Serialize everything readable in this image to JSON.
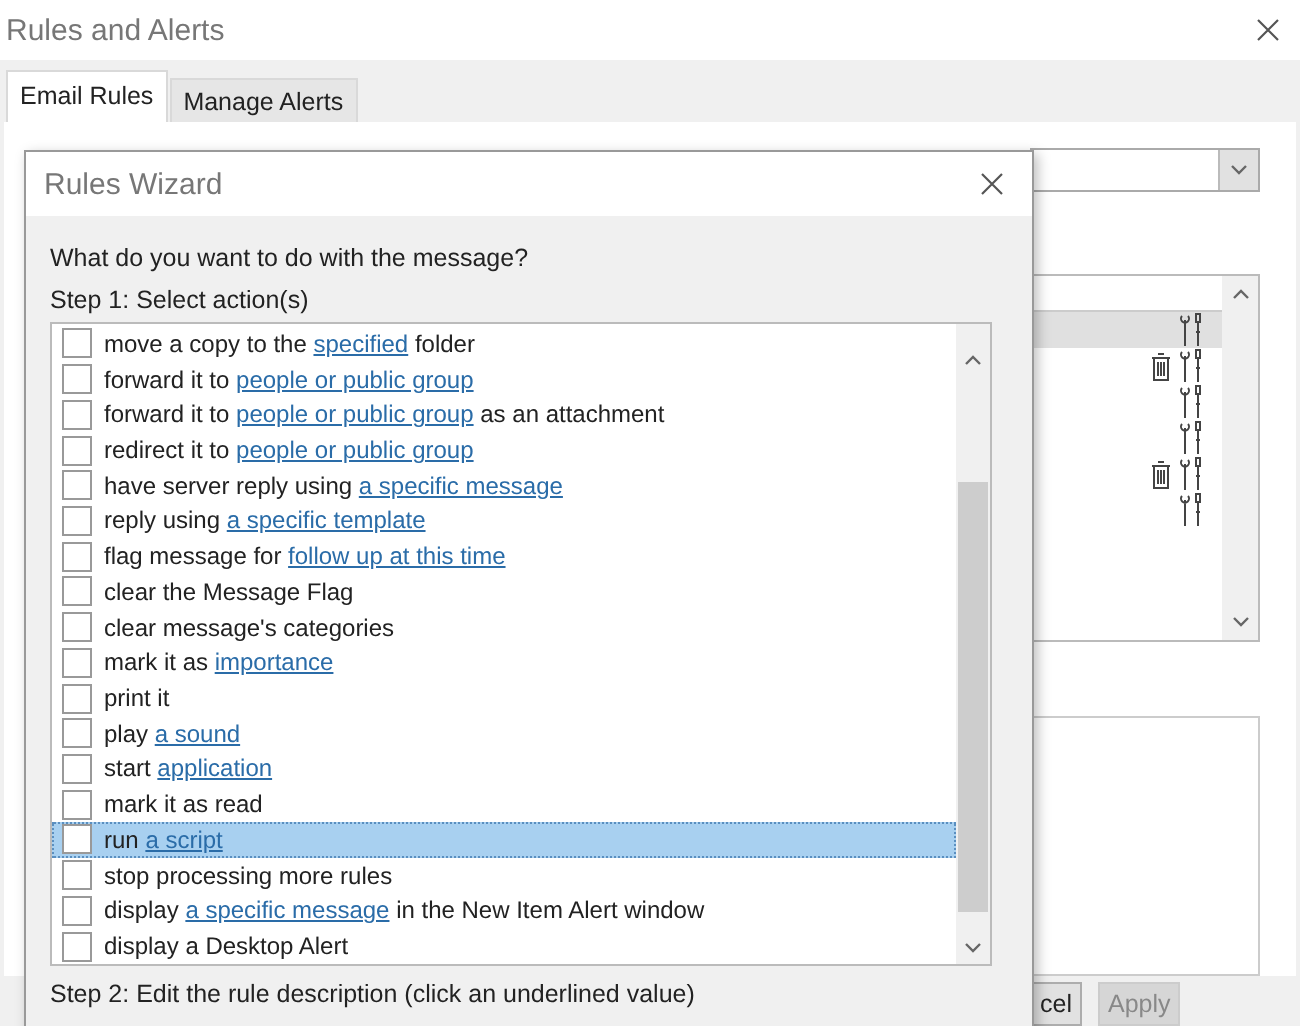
{
  "window": {
    "title": "Rules and Alerts"
  },
  "tabs": [
    {
      "label": "Email Rules",
      "selected": true
    },
    {
      "label": "Manage Alerts",
      "selected": false
    }
  ],
  "rules_list": {
    "rows": [
      {
        "selected": true,
        "deletable": false
      },
      {
        "selected": false,
        "deletable": true
      },
      {
        "selected": false,
        "deletable": false
      },
      {
        "selected": false,
        "deletable": false
      },
      {
        "selected": false,
        "deletable": true
      },
      {
        "selected": false,
        "deletable": false
      }
    ]
  },
  "buttons": [
    {
      "label": "cel",
      "disabled": false
    },
    {
      "label": "Apply",
      "disabled": true
    }
  ],
  "wizard": {
    "title": "Rules Wizard",
    "question": "What do you want to do with the message?",
    "step1": "Step 1: Select action(s)",
    "actions": [
      {
        "checked": false,
        "selected": false,
        "parts": [
          {
            "kind": "text",
            "text": "move a copy to the "
          },
          {
            "kind": "link",
            "text": "specified"
          },
          {
            "kind": "text",
            "text": " folder"
          }
        ]
      },
      {
        "checked": false,
        "selected": false,
        "parts": [
          {
            "kind": "text",
            "text": "forward it to "
          },
          {
            "kind": "link",
            "text": "people or public group"
          }
        ]
      },
      {
        "checked": false,
        "selected": false,
        "parts": [
          {
            "kind": "text",
            "text": "forward it to "
          },
          {
            "kind": "link",
            "text": "people or public group"
          },
          {
            "kind": "text",
            "text": " as an attachment"
          }
        ]
      },
      {
        "checked": false,
        "selected": false,
        "parts": [
          {
            "kind": "text",
            "text": "redirect it to "
          },
          {
            "kind": "link",
            "text": "people or public group"
          }
        ]
      },
      {
        "checked": false,
        "selected": false,
        "parts": [
          {
            "kind": "text",
            "text": "have server reply using "
          },
          {
            "kind": "link",
            "text": "a specific message"
          }
        ]
      },
      {
        "checked": false,
        "selected": false,
        "parts": [
          {
            "kind": "text",
            "text": "reply using "
          },
          {
            "kind": "link",
            "text": "a specific template"
          }
        ]
      },
      {
        "checked": false,
        "selected": false,
        "parts": [
          {
            "kind": "text",
            "text": "flag message for "
          },
          {
            "kind": "link",
            "text": "follow up at this time"
          }
        ]
      },
      {
        "checked": false,
        "selected": false,
        "parts": [
          {
            "kind": "text",
            "text": "clear the Message Flag"
          }
        ]
      },
      {
        "checked": false,
        "selected": false,
        "parts": [
          {
            "kind": "text",
            "text": "clear message's categories"
          }
        ]
      },
      {
        "checked": false,
        "selected": false,
        "parts": [
          {
            "kind": "text",
            "text": "mark it as "
          },
          {
            "kind": "link",
            "text": "importance"
          }
        ]
      },
      {
        "checked": false,
        "selected": false,
        "parts": [
          {
            "kind": "text",
            "text": "print it"
          }
        ]
      },
      {
        "checked": false,
        "selected": false,
        "parts": [
          {
            "kind": "text",
            "text": "play "
          },
          {
            "kind": "link",
            "text": "a sound"
          }
        ]
      },
      {
        "checked": false,
        "selected": false,
        "parts": [
          {
            "kind": "text",
            "text": "start "
          },
          {
            "kind": "link",
            "text": "application"
          }
        ]
      },
      {
        "checked": false,
        "selected": false,
        "parts": [
          {
            "kind": "text",
            "text": "mark it as read"
          }
        ]
      },
      {
        "checked": false,
        "selected": true,
        "parts": [
          {
            "kind": "text",
            "text": "run "
          },
          {
            "kind": "link",
            "text": "a script"
          }
        ]
      },
      {
        "checked": false,
        "selected": false,
        "parts": [
          {
            "kind": "text",
            "text": "stop processing more rules"
          }
        ]
      },
      {
        "checked": false,
        "selected": false,
        "parts": [
          {
            "kind": "text",
            "text": "display "
          },
          {
            "kind": "link",
            "text": "a specific message"
          },
          {
            "kind": "text",
            "text": " in the New Item Alert window"
          }
        ]
      },
      {
        "checked": false,
        "selected": false,
        "parts": [
          {
            "kind": "text",
            "text": "display a Desktop Alert"
          }
        ]
      }
    ],
    "step2": "Step 2: Edit the rule description (click an underlined value)"
  }
}
